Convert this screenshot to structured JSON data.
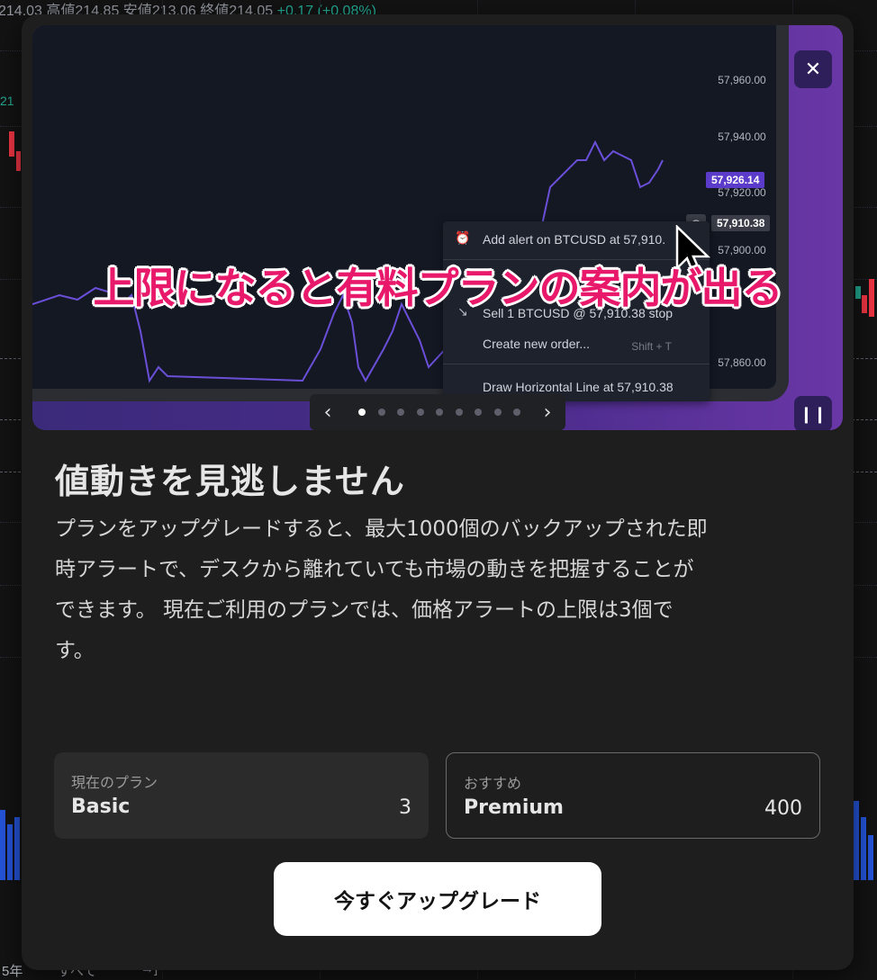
{
  "background": {
    "ticker": {
      "last": "214.03",
      "high_label": "高値",
      "high": "214.85",
      "low_label": "安値",
      "low": "213.06",
      "close_label": "終値",
      "close": "214.05",
      "change": "+0.17 (+0.08%)"
    },
    "side_value": "21",
    "bottom_toolbar": {
      "range": "5年",
      "all": "すべて",
      "goto_icon": "goto-date-icon"
    }
  },
  "hero": {
    "price_scale": [
      "57,960.00",
      "57,940.00",
      "57,920.00",
      "57,900.00",
      "57,860.00"
    ],
    "price_tag_alert": "57,926.14",
    "price_tag_cursor": "57,910.38",
    "context_menu": {
      "add_alert": "Add alert on BTCUSD at 57,910.",
      "sell": "Sell 1 BTCUSD @ 57,910.38 stop",
      "create_order": "Create new order...",
      "create_order_shortcut": "Shift + T",
      "draw_line": "Draw Horizontal Line at 57,910.38"
    },
    "overlay_caption": "上限になると有料プランの案内が出る",
    "close_icon": "close-icon",
    "pause_icon": "pause-icon",
    "pager": {
      "prev": "‹",
      "next": "›",
      "dot_count": 9,
      "active_index": 0
    }
  },
  "modal": {
    "title": "値動きを見逃しません",
    "description_lines": [
      "プランをアップグレードすると、最大1000個のバックアップされた即",
      "時アラートで、デスクから離れていても市場の動きを把握することが",
      "できます。 現在ご利用のプランでは、価格アラートの上限は3個で",
      "す。"
    ],
    "current_plan": {
      "caption": "現在のプラン",
      "name": "Basic",
      "alerts": "3"
    },
    "recommended_plan": {
      "caption": "おすすめ",
      "name": "Premium",
      "alerts": "400"
    },
    "upgrade_button": "今すぐアップグレード"
  },
  "colors": {
    "accent_purple": "#5b3bc9",
    "caption_pink": "#e8196a",
    "modal_bg": "#1e1e1e"
  }
}
